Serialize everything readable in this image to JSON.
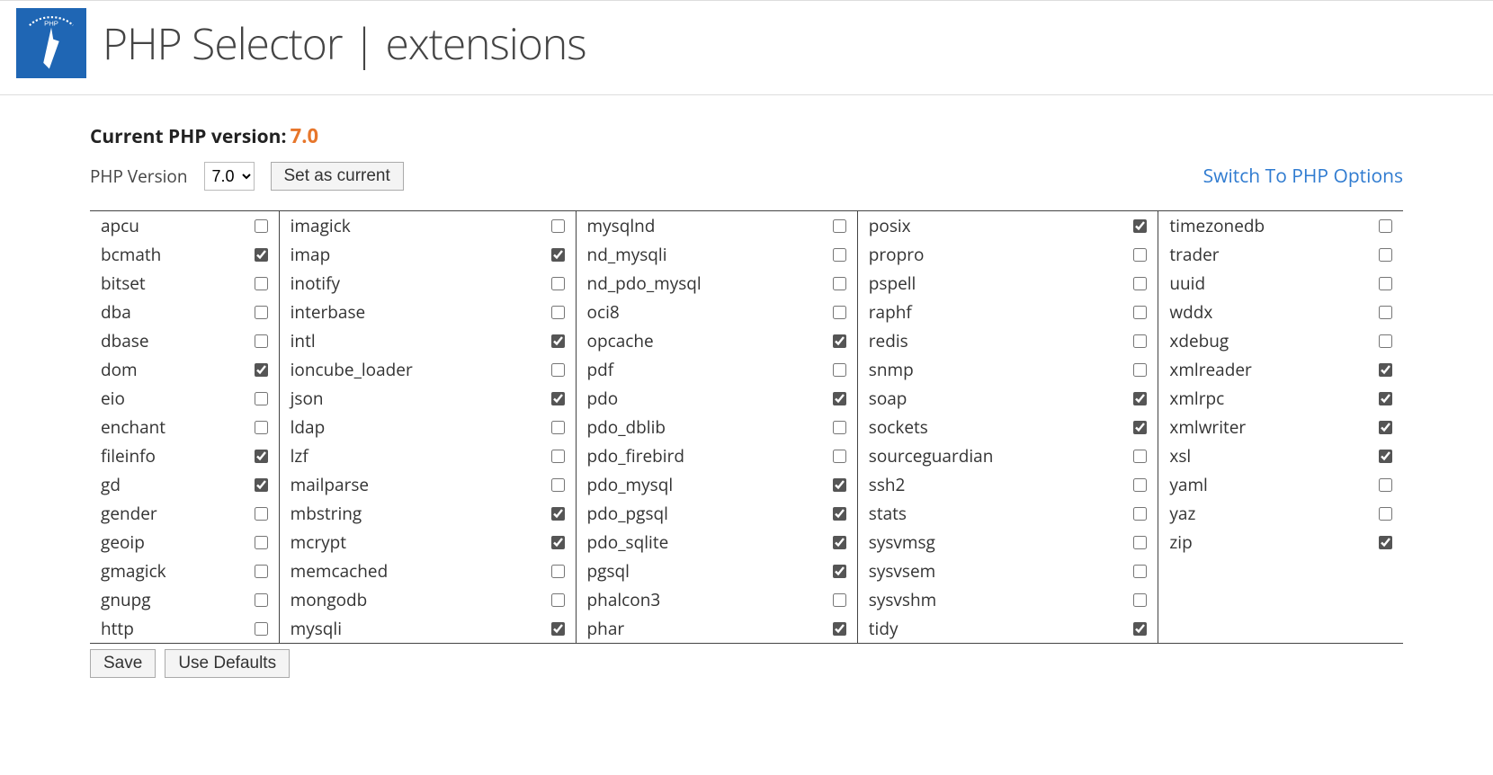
{
  "header": {
    "title": "PHP Selector | extensions"
  },
  "version": {
    "current_label": "Current PHP version:",
    "current_value": "7.0",
    "picker_label": "PHP Version",
    "selected_option": "7.0",
    "set_button": "Set as current",
    "options_link": "Switch To PHP Options"
  },
  "columns": [
    [
      {
        "name": "apcu",
        "checked": false
      },
      {
        "name": "bcmath",
        "checked": true
      },
      {
        "name": "bitset",
        "checked": false
      },
      {
        "name": "dba",
        "checked": false
      },
      {
        "name": "dbase",
        "checked": false
      },
      {
        "name": "dom",
        "checked": true
      },
      {
        "name": "eio",
        "checked": false
      },
      {
        "name": "enchant",
        "checked": false
      },
      {
        "name": "fileinfo",
        "checked": true
      },
      {
        "name": "gd",
        "checked": true
      },
      {
        "name": "gender",
        "checked": false
      },
      {
        "name": "geoip",
        "checked": false
      },
      {
        "name": "gmagick",
        "checked": false
      },
      {
        "name": "gnupg",
        "checked": false
      },
      {
        "name": "http",
        "checked": false
      }
    ],
    [
      {
        "name": "imagick",
        "checked": false
      },
      {
        "name": "imap",
        "checked": true
      },
      {
        "name": "inotify",
        "checked": false
      },
      {
        "name": "interbase",
        "checked": false
      },
      {
        "name": "intl",
        "checked": true
      },
      {
        "name": "ioncube_loader",
        "checked": false
      },
      {
        "name": "json",
        "checked": true
      },
      {
        "name": "ldap",
        "checked": false
      },
      {
        "name": "lzf",
        "checked": false
      },
      {
        "name": "mailparse",
        "checked": false
      },
      {
        "name": "mbstring",
        "checked": true
      },
      {
        "name": "mcrypt",
        "checked": true
      },
      {
        "name": "memcached",
        "checked": false
      },
      {
        "name": "mongodb",
        "checked": false
      },
      {
        "name": "mysqli",
        "checked": true
      }
    ],
    [
      {
        "name": "mysqlnd",
        "checked": false
      },
      {
        "name": "nd_mysqli",
        "checked": false
      },
      {
        "name": "nd_pdo_mysql",
        "checked": false
      },
      {
        "name": "oci8",
        "checked": false
      },
      {
        "name": "opcache",
        "checked": true
      },
      {
        "name": "pdf",
        "checked": false
      },
      {
        "name": "pdo",
        "checked": true
      },
      {
        "name": "pdo_dblib",
        "checked": false
      },
      {
        "name": "pdo_firebird",
        "checked": false
      },
      {
        "name": "pdo_mysql",
        "checked": true
      },
      {
        "name": "pdo_pgsql",
        "checked": true
      },
      {
        "name": "pdo_sqlite",
        "checked": true
      },
      {
        "name": "pgsql",
        "checked": true
      },
      {
        "name": "phalcon3",
        "checked": false
      },
      {
        "name": "phar",
        "checked": true
      }
    ],
    [
      {
        "name": "posix",
        "checked": true
      },
      {
        "name": "propro",
        "checked": false
      },
      {
        "name": "pspell",
        "checked": false
      },
      {
        "name": "raphf",
        "checked": false
      },
      {
        "name": "redis",
        "checked": false
      },
      {
        "name": "snmp",
        "checked": false
      },
      {
        "name": "soap",
        "checked": true
      },
      {
        "name": "sockets",
        "checked": true
      },
      {
        "name": "sourceguardian",
        "checked": false
      },
      {
        "name": "ssh2",
        "checked": false
      },
      {
        "name": "stats",
        "checked": false
      },
      {
        "name": "sysvmsg",
        "checked": false
      },
      {
        "name": "sysvsem",
        "checked": false
      },
      {
        "name": "sysvshm",
        "checked": false
      },
      {
        "name": "tidy",
        "checked": true
      }
    ],
    [
      {
        "name": "timezonedb",
        "checked": false
      },
      {
        "name": "trader",
        "checked": false
      },
      {
        "name": "uuid",
        "checked": false
      },
      {
        "name": "wddx",
        "checked": false
      },
      {
        "name": "xdebug",
        "checked": false
      },
      {
        "name": "xmlreader",
        "checked": true
      },
      {
        "name": "xmlrpc",
        "checked": true
      },
      {
        "name": "xmlwriter",
        "checked": true
      },
      {
        "name": "xsl",
        "checked": true
      },
      {
        "name": "yaml",
        "checked": false
      },
      {
        "name": "yaz",
        "checked": false
      },
      {
        "name": "zip",
        "checked": true
      }
    ]
  ],
  "footer": {
    "save": "Save",
    "defaults": "Use Defaults"
  }
}
